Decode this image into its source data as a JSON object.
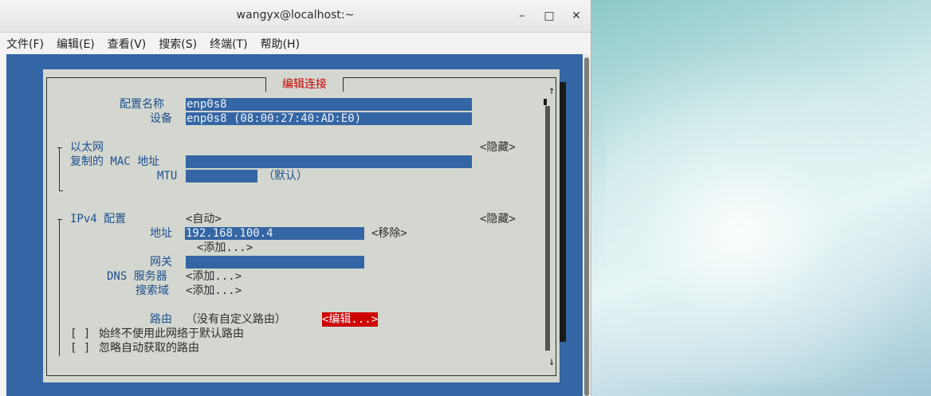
{
  "window": {
    "title": "wangyx@localhost:~",
    "min": "–",
    "max": "□",
    "close": "✕"
  },
  "menu": [
    "文件(F)",
    "编辑(E)",
    "查看(V)",
    "搜索(S)",
    "终端(T)",
    "帮助(H)"
  ],
  "dialog": {
    "title": "编辑连接",
    "scroll_up": "↑",
    "scroll_down": "↓",
    "profile_name_label": "配置名称",
    "profile_name_value": "enp0s8",
    "device_label": "设备",
    "device_value": "enp0s8 (08:00:27:40:AD:E0)",
    "ethernet": {
      "section_label": "以太网",
      "toggle": "<隐藏>",
      "cloned_mac_label": "复制的 MAC 地址",
      "cloned_mac_value": "",
      "mtu_label": "MTU",
      "mtu_value": "",
      "mtu_default": "（默认）"
    },
    "ipv4": {
      "section_label": "IPv4 配置",
      "method": "<自动>",
      "toggle": "<隐藏>",
      "address_label": "地址",
      "address_value": "192.168.100.4",
      "remove": "<移除>",
      "add_address": "<添加...>",
      "gateway_label": "网关",
      "gateway_value": "",
      "dns_label": "DNS 服务器",
      "dns_add": "<添加...>",
      "search_label": "搜索域",
      "search_add": "<添加...>",
      "routing_label": "路由",
      "routing_value": "（没有自定义路由）",
      "routing_edit": "<编辑...>",
      "never_default_check": "[ ]",
      "never_default_label": "始终不使用此网络于默认路由",
      "ignore_routes_check": "[ ]",
      "ignore_routes_label": "忽略自动获取的路由"
    }
  }
}
